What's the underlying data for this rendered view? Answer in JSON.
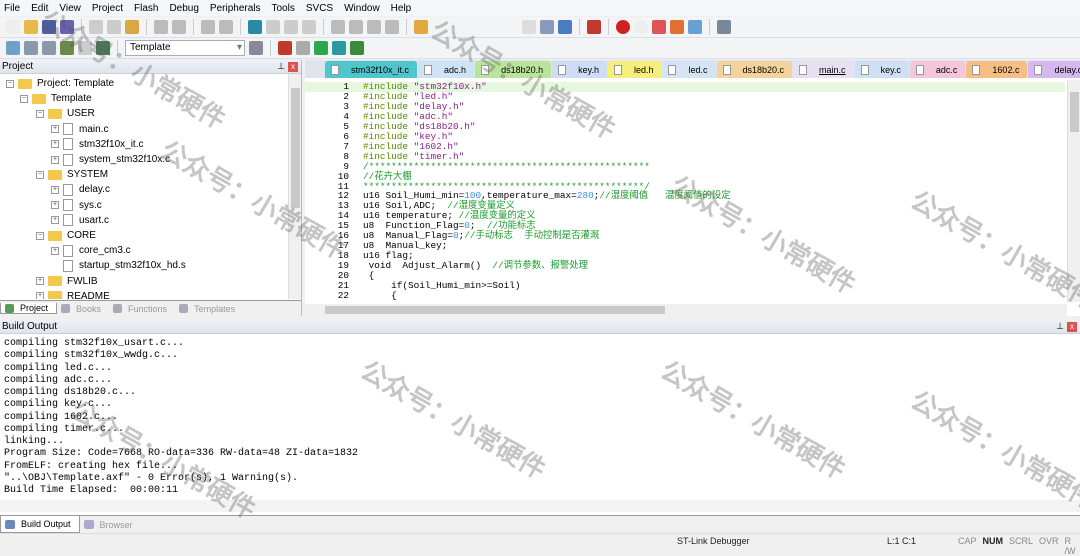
{
  "menu": [
    "File",
    "Edit",
    "View",
    "Project",
    "Flash",
    "Debug",
    "Peripherals",
    "Tools",
    "SVCS",
    "Window",
    "Help"
  ],
  "toolbar": {
    "target": "Template"
  },
  "project_panel": {
    "title": "Project",
    "root": "Project: Template",
    "target": "Template",
    "groups": [
      {
        "name": "USER",
        "files": [
          "main.c",
          "stm32f10x_it.c",
          "system_stm32f10x.c"
        ]
      },
      {
        "name": "SYSTEM",
        "files": [
          "delay.c",
          "sys.c",
          "usart.c"
        ]
      },
      {
        "name": "CORE",
        "files": [
          "core_cm3.c",
          "startup_stm32f10x_hd.s"
        ]
      },
      {
        "name": "FWLIB",
        "files": []
      },
      {
        "name": "README",
        "files": []
      }
    ],
    "tabs": [
      "Project",
      "Books",
      "Functions",
      "Templates"
    ]
  },
  "editor": {
    "tabs": [
      {
        "label": "stm32f10x_it.c",
        "color": "#4fc6cc"
      },
      {
        "label": "adc.h",
        "color": "#cfe3f7"
      },
      {
        "label": "ds18b20.h",
        "color": "#b9e59a"
      },
      {
        "label": "key.h",
        "color": "#cfdcf5"
      },
      {
        "label": "led.h",
        "color": "#f7ee7a"
      },
      {
        "label": "led.c",
        "color": "#d5e4f5"
      },
      {
        "label": "ds18b20.c",
        "color": "#f1d39b"
      },
      {
        "label": "main.c",
        "color": "#e6e0f2",
        "active": true
      },
      {
        "label": "key.c",
        "color": "#cfe0f5"
      },
      {
        "label": "adc.c",
        "color": "#f3c7d9"
      },
      {
        "label": "1602.c",
        "color": "#f6be82"
      },
      {
        "label": "delay.c",
        "color": "#d4b8ee"
      }
    ],
    "lines": [
      [
        "1",
        "#include",
        "\"stm32f10x.h\""
      ],
      [
        "2",
        "#include",
        "\"led.h\""
      ],
      [
        "3",
        "#include",
        "\"delay.h\""
      ],
      [
        "4",
        "#include",
        "\"adc.h\""
      ],
      [
        "5",
        "#include",
        "\"ds18b20.h\""
      ],
      [
        "6",
        "#include",
        "\"key.h\""
      ],
      [
        "7",
        "#include",
        "\"1602.h\""
      ],
      [
        "8",
        "#include",
        "\"timer.h\""
      ],
      [
        "9",
        "/**************************************************"
      ],
      [
        "10",
        "//花卉大棚"
      ],
      [
        "11",
        "**************************************************/"
      ],
      [
        "12",
        "u16 Soil_Humi_min=100,temperature_max=280;//湿度阈值   温度阈值的设定"
      ],
      [
        "13",
        "u16 Soil,ADC;  //湿度变量定义"
      ],
      [
        "14",
        "u16 temperature; //温度变量的定义"
      ],
      [
        "15",
        "u8  Function_Flag=0;  //功能标志"
      ],
      [
        "16",
        "u8  Manual_Flag=0;//手动标志  手动控制是否灌溉"
      ],
      [
        "17",
        "u8  Manual_key;"
      ],
      [
        "18",
        "u16 flag;"
      ],
      [
        "19",
        " void  Adjust_Alarm()  //调节参数、报警处理"
      ],
      [
        "20",
        " {"
      ],
      [
        "21",
        "     if(Soil_Humi_min>=Soil)"
      ],
      [
        "22",
        "     {"
      ]
    ]
  },
  "build_output": {
    "title": "Build Output",
    "lines": [
      "compiling stm32f10x_usart.c...",
      "compiling stm32f10x_wwdg.c...",
      "compiling led.c...",
      "compiling adc.c...",
      "compiling ds18b20.c...",
      "compiling key.c...",
      "compiling 1602.c...",
      "compiling timer.c...",
      "linking...",
      "Program Size: Code=7668 RO-data=336 RW-data=48 ZI-data=1832",
      "FromELF: creating hex file...",
      "\"..\\OBJ\\Template.axf\" - 0 Error(s), 1 Warning(s).",
      "Build Time Elapsed:  00:00:11"
    ],
    "tabs": [
      "Build Output",
      "Browser"
    ]
  },
  "status": {
    "debugger": "ST-Link Debugger",
    "position": "L:1 C:1",
    "indicators": [
      "CAP",
      "NUM",
      "SCRL",
      "OVR",
      "R /W"
    ]
  },
  "watermark": "公众号：小常硬件"
}
